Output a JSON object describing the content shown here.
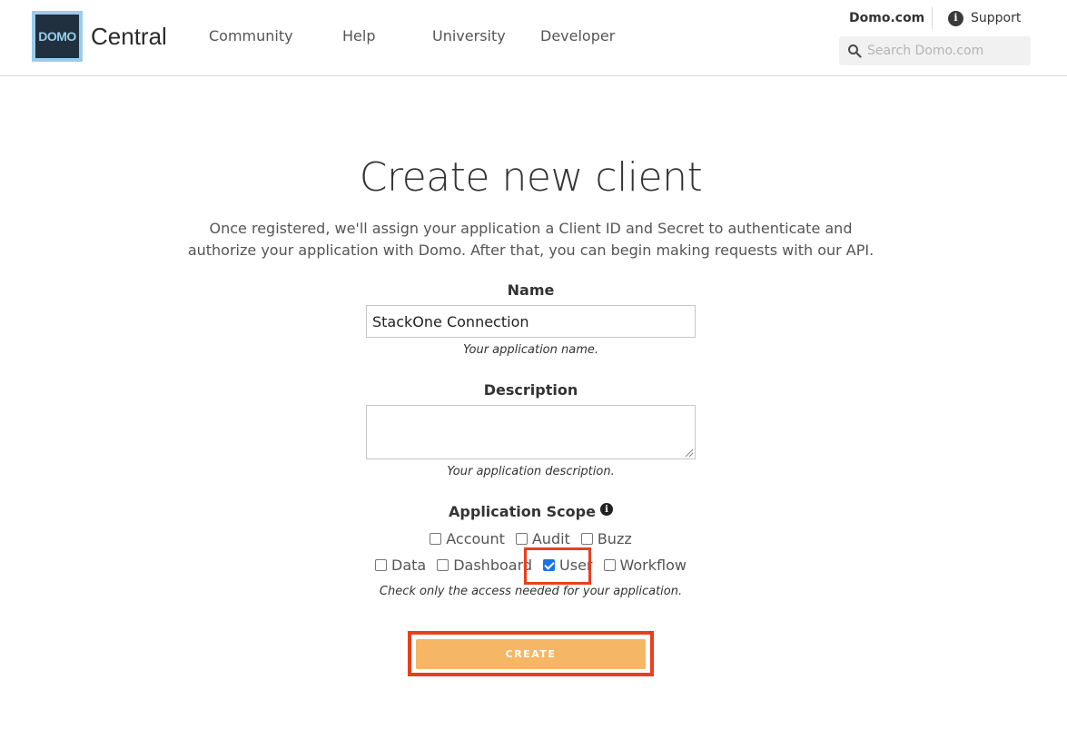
{
  "header": {
    "logo_text": "DOMO",
    "brand": "Central",
    "nav": [
      "Community",
      "Help",
      "University",
      "Developer"
    ],
    "domo_link": "Domo.com",
    "support_link": "Support",
    "search_placeholder": "Search Domo.com"
  },
  "main": {
    "title": "Create new client",
    "intro": "Once registered, we'll assign your application a Client ID and Secret to authenticate and authorize your application with Domo. After that, you can begin making requests with our API.",
    "name_label": "Name",
    "name_value": "StackOne Connection",
    "name_hint": "Your application name.",
    "description_label": "Description",
    "description_value": "",
    "description_hint": "Your application description.",
    "scope_label": "Application Scope",
    "scopes": [
      {
        "label": "Account",
        "checked": false
      },
      {
        "label": "Audit",
        "checked": false
      },
      {
        "label": "Buzz",
        "checked": false
      },
      {
        "label": "Data",
        "checked": false
      },
      {
        "label": "Dashboard",
        "checked": false
      },
      {
        "label": "User",
        "checked": true
      },
      {
        "label": "Workflow",
        "checked": false
      }
    ],
    "scope_hint": "Check only the access needed for your application.",
    "create_label": "CREATE"
  },
  "colors": {
    "accent_button": "#f5b766",
    "highlight": "#e8401c",
    "checkbox_checked": "#1a73e8"
  }
}
